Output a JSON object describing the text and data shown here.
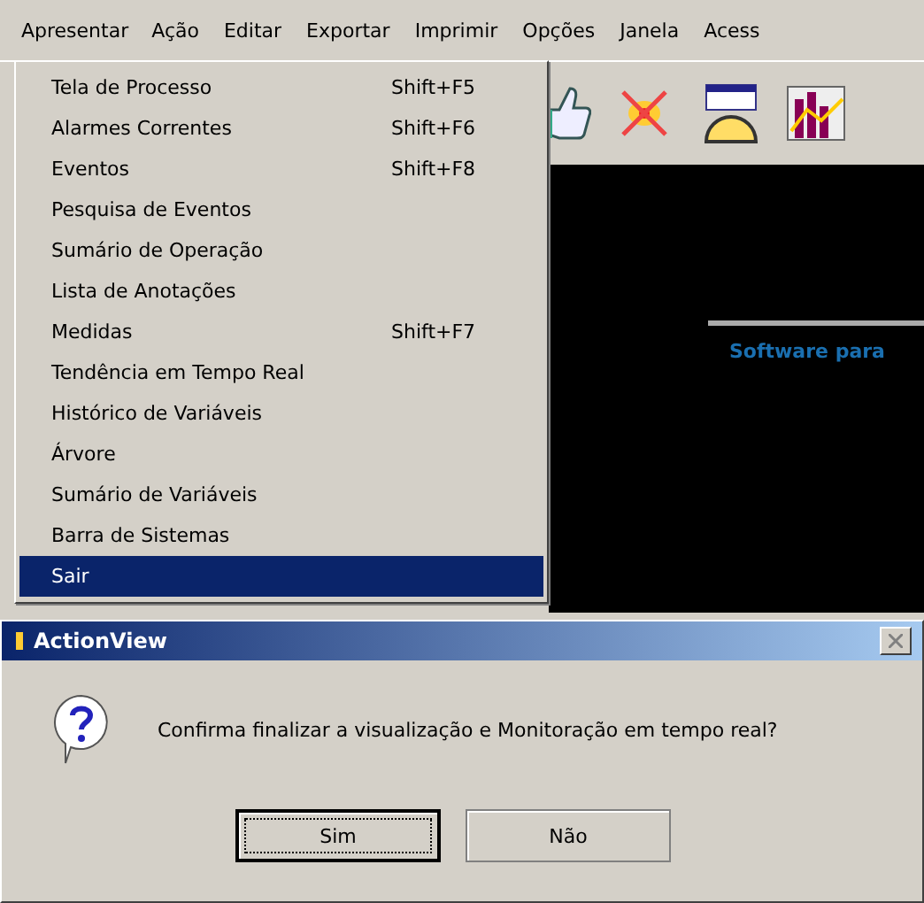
{
  "menu_bar": [
    {
      "label": "Apresentar",
      "selected": true
    },
    {
      "label": "Ação",
      "selected": false
    },
    {
      "label": "Editar",
      "selected": false
    },
    {
      "label": "Exportar",
      "selected": false
    },
    {
      "label": "Imprimir",
      "selected": false
    },
    {
      "label": "Opções",
      "selected": false
    },
    {
      "label": "Janela",
      "selected": false
    },
    {
      "label": "Acess",
      "selected": false
    }
  ],
  "dropdown": [
    {
      "label": "Tela de Processo",
      "shortcut": "Shift+F5",
      "selected": false
    },
    {
      "label": "Alarmes Correntes",
      "shortcut": "Shift+F6",
      "selected": false
    },
    {
      "label": "Eventos",
      "shortcut": "Shift+F8",
      "selected": false
    },
    {
      "label": "Pesquisa de Eventos",
      "selected": false
    },
    {
      "label": "Sumário de Operação",
      "selected": false
    },
    {
      "label": "Lista de Anotações",
      "selected": false
    },
    {
      "label": "Medidas",
      "shortcut": "Shift+F7",
      "selected": false
    },
    {
      "label": "Tendência em Tempo Real",
      "selected": false
    },
    {
      "label": "Histórico de Variáveis",
      "selected": false
    },
    {
      "label": "Árvore",
      "selected": false
    },
    {
      "label": "Sumário de Variáveis",
      "selected": false
    },
    {
      "label": "Barra de Sistemas",
      "selected": false
    },
    {
      "label": "Sair",
      "selected": true
    }
  ],
  "canvas": {
    "subtitle": "Software para"
  },
  "dialog": {
    "title": "ActionView",
    "message": "Confirma finalizar a visualização e Monitoração em tempo real?",
    "buttons": [
      {
        "label": "Sim",
        "selected": true
      },
      {
        "label": "Não",
        "selected": false
      }
    ]
  }
}
